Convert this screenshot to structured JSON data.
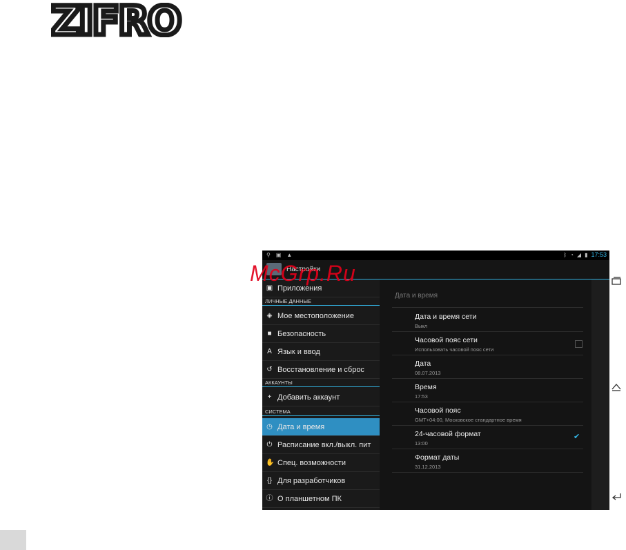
{
  "logo": {
    "text": "ZIFRO"
  },
  "watermark": "McGrp.Ru",
  "statusbar": {
    "time": "17:53"
  },
  "actionbar": {
    "title": "Настройки"
  },
  "sidebar": {
    "items": [
      {
        "label": "Приложения",
        "icon": "apps-icon"
      },
      {
        "section": "ЛИЧНЫЕ ДАННЫЕ"
      },
      {
        "label": "Мое местоположение",
        "icon": "location-icon"
      },
      {
        "label": "Безопасность",
        "icon": "lock-icon"
      },
      {
        "label": "Язык и ввод",
        "icon": "language-icon"
      },
      {
        "label": "Восстановление и сброс",
        "icon": "restore-icon"
      },
      {
        "section": "АККАУНТЫ"
      },
      {
        "label": "Добавить аккаунт",
        "icon": "plus-icon"
      },
      {
        "section": "СИСТЕМА"
      },
      {
        "label": "Дата и время",
        "icon": "clock-icon",
        "active": true
      },
      {
        "label": "Расписание вкл./выкл. пит",
        "icon": "power-icon"
      },
      {
        "label": "Спец. возможности",
        "icon": "hand-icon"
      },
      {
        "label": "Для разработчиков",
        "icon": "braces-icon"
      },
      {
        "label": "О планшетном ПК",
        "icon": "info-icon"
      }
    ]
  },
  "main": {
    "heading": "Дата и время",
    "rows": [
      {
        "title": "Дата и время сети",
        "subtitle": "Выкл"
      },
      {
        "title": "Часовой пояс сети",
        "subtitle": "Использовать часовой пояс сети",
        "checkbox": false
      },
      {
        "title": "Дата",
        "subtitle": "08.07.2013"
      },
      {
        "title": "Время",
        "subtitle": "17:53"
      },
      {
        "title": "Часовой пояс",
        "subtitle": "GMT+04:00, Московское стандартное время"
      },
      {
        "title": "24-часовой формат",
        "subtitle": "13:00",
        "checkbox": true
      },
      {
        "title": "Формат даты",
        "subtitle": "31.12.2013"
      }
    ]
  },
  "colors": {
    "accent": "#33b5e5",
    "active": "#2f8fc2",
    "watermark": "#e1001a"
  }
}
